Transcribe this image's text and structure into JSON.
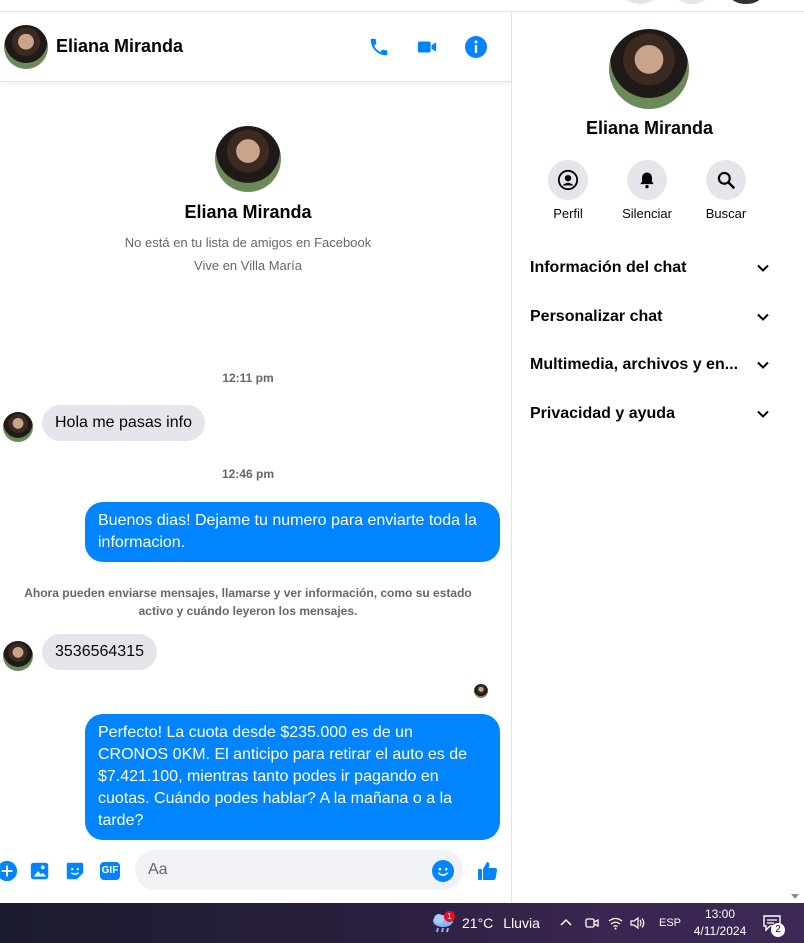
{
  "contact": {
    "name": "Eliana Miranda",
    "not_friend": "No está en tu lista de amigos en Facebook",
    "lives_in": "Vive en Villa María"
  },
  "messages": {
    "time1": "12:11 pm",
    "in1": "Hola me pasas info",
    "time2": "12:46 pm",
    "out1": "Buenos dias! Dejame tu numero para enviarte toda la informacion.",
    "notice": "Ahora pueden enviarse mensajes, llamarse y ver información, como su estado activo y cuándo leyeron los mensajes.",
    "in2": "3536564315",
    "out2": "Perfecto! La cuota desde $235.000 es de un CRONOS 0KM. El anticipo para retirar el auto es de $7.421.100, mientras tanto podes ir pagando en cuotas. Cuándo podes hablar? A la mañana o a la tarde?"
  },
  "composer": {
    "placeholder": "Aa",
    "gif_label": "GIF"
  },
  "info_panel": {
    "actions": [
      {
        "label": "Perfil",
        "icon": "profile-icon"
      },
      {
        "label": "Silenciar",
        "icon": "bell-icon"
      },
      {
        "label": "Buscar",
        "icon": "search-icon"
      }
    ],
    "sections": [
      {
        "label": "Información del chat"
      },
      {
        "label": "Personalizar chat"
      },
      {
        "label": "Multimedia, archivos y en..."
      },
      {
        "label": "Privacidad y ayuda"
      }
    ]
  },
  "taskbar": {
    "weather_temp": "21°C",
    "weather_desc": "Lluvia",
    "weather_badge": "1",
    "lang": "ESP",
    "time": "13:00",
    "date": "4/11/2024",
    "notif_count": "2"
  },
  "colors": {
    "accent": "#0084ff",
    "bubble_in": "#e4e6eb",
    "text_secondary": "#65676b"
  }
}
